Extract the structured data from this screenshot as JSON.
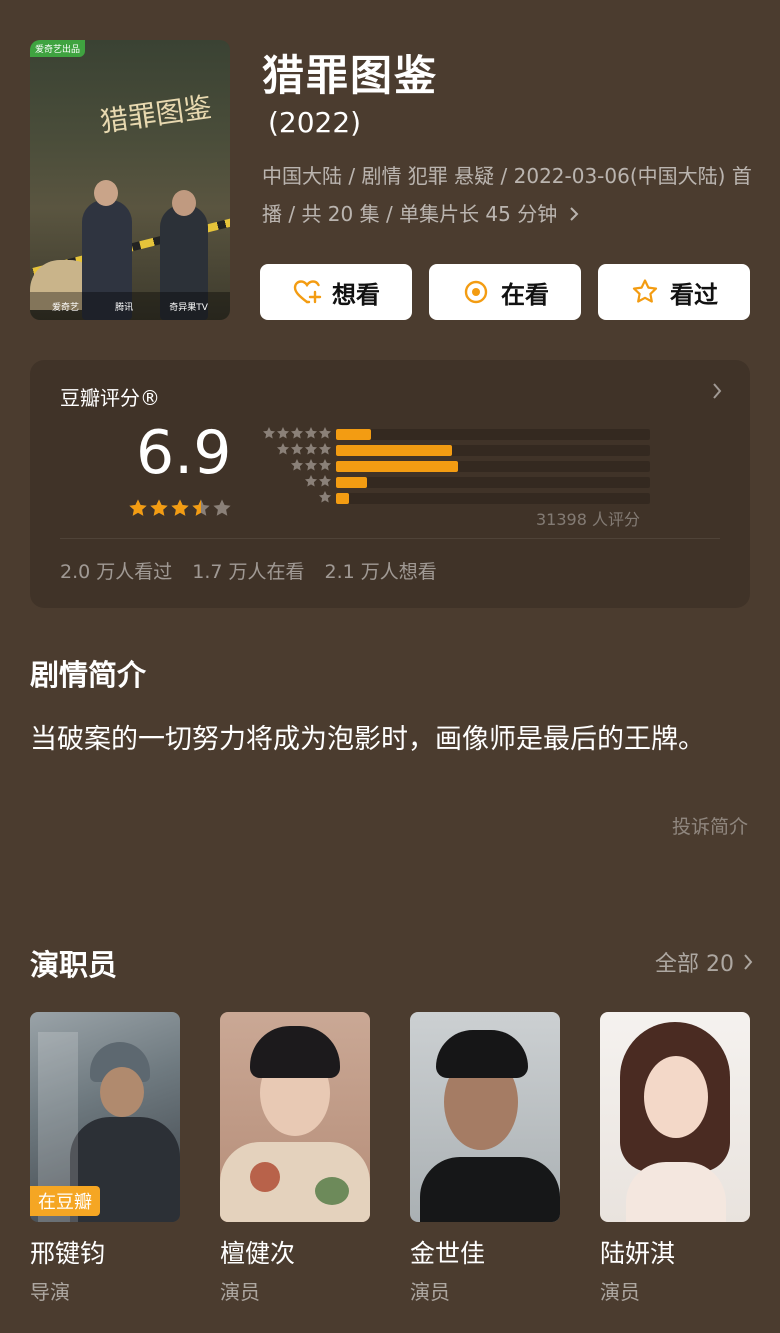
{
  "header": {
    "poster_badge": "爱奇艺出品",
    "poster_title": "猎罪图鉴",
    "poster_sponsors": [
      "爱奇艺",
      "腾讯",
      "奇异果TV"
    ],
    "title": "猎罪图鉴",
    "year": "(2022)",
    "meta": "中国大陆 / 剧情 犯罪 悬疑 / 2022-03-06(中国大陆) 首播 / 共 20 集 / 单集片长 45 分钟"
  },
  "actions": [
    {
      "label": "想看",
      "icon": "heart-plus-icon"
    },
    {
      "label": "在看",
      "icon": "target-icon"
    },
    {
      "label": "看过",
      "icon": "star-outline-icon"
    }
  ],
  "rating": {
    "title": "豆瓣评分®",
    "score": "6.9",
    "star_value": 3.5,
    "distribution": [
      {
        "stars": 5,
        "fraction": 0.11
      },
      {
        "stars": 4,
        "fraction": 0.37
      },
      {
        "stars": 3,
        "fraction": 0.39
      },
      {
        "stars": 2,
        "fraction": 0.1
      },
      {
        "stars": 1,
        "fraction": 0.04
      }
    ],
    "count": "31398 人评分",
    "stats": [
      "2.0 万人看过",
      "1.7 万人在看",
      "2.1 万人想看"
    ],
    "colors": {
      "accent": "#f39c12",
      "background": "#4b3c2f"
    }
  },
  "synopsis": {
    "title": "剧情简介",
    "text": "当破案的一切努力将成为泡影时，画像师是最后的王牌。",
    "report": "投诉简介"
  },
  "cast": {
    "title": "演职员",
    "all_label": "全部 20",
    "members": [
      {
        "name": "邢键钧",
        "role": "导演",
        "tag": "在豆瓣"
      },
      {
        "name": "檀健次",
        "role": "演员"
      },
      {
        "name": "金世佳",
        "role": "演员"
      },
      {
        "name": "陆妍淇",
        "role": "演员"
      }
    ]
  }
}
